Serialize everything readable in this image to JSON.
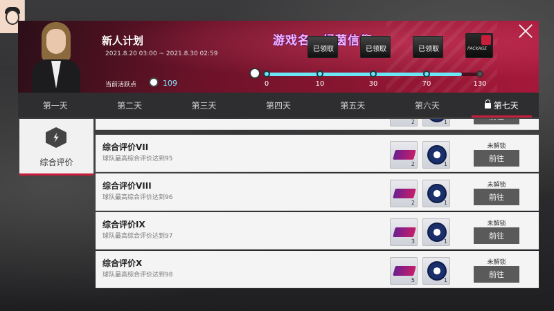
{
  "event": {
    "title": "新人计划",
    "period": "2021.8.20 03:00 ~ 2021.8.30 02:59",
    "activity_label": "当前活跃点",
    "activity_value": "109",
    "watermark": "游戏名：绿茵信仰"
  },
  "rewards": [
    {
      "status": "已领取"
    },
    {
      "status": "已领取"
    },
    {
      "status": "已领取"
    },
    {
      "status": "",
      "label": "PACKAGE"
    }
  ],
  "progress": {
    "current": 109,
    "milestones": [
      "0",
      "10",
      "30",
      "70",
      "130"
    ],
    "accent": "#6ae6f7"
  },
  "tabs": [
    "第一天",
    "第二天",
    "第三天",
    "第四天",
    "第五天",
    "第六天",
    "第七天"
  ],
  "active_tab": "第七天",
  "category": {
    "label": "综合评价"
  },
  "tasks": [
    {
      "title": "",
      "desc": "",
      "reward1_qty": "2",
      "reward2_qty": "1",
      "status": "",
      "button": "前往"
    },
    {
      "title": "综合评价VII",
      "desc": "球队最高综合评价达到95",
      "reward1_qty": "2",
      "reward2_qty": "1",
      "status": "未解锁",
      "button": "前往"
    },
    {
      "title": "综合评价VIII",
      "desc": "球队最高综合评价达到96",
      "reward1_qty": "2",
      "reward2_qty": "1",
      "status": "未解锁",
      "button": "前往"
    },
    {
      "title": "综合评价IX",
      "desc": "球队最高综合评价达到97",
      "reward1_qty": "3",
      "reward2_qty": "1",
      "status": "未解锁",
      "button": "前往"
    },
    {
      "title": "综合评价X",
      "desc": "球队最高综合评价达到98",
      "reward1_qty": "5",
      "reward2_qty": "1",
      "status": "未解锁",
      "button": "前往"
    }
  ],
  "colors": {
    "accent": "#c81e3c",
    "header": "#8e1632"
  }
}
